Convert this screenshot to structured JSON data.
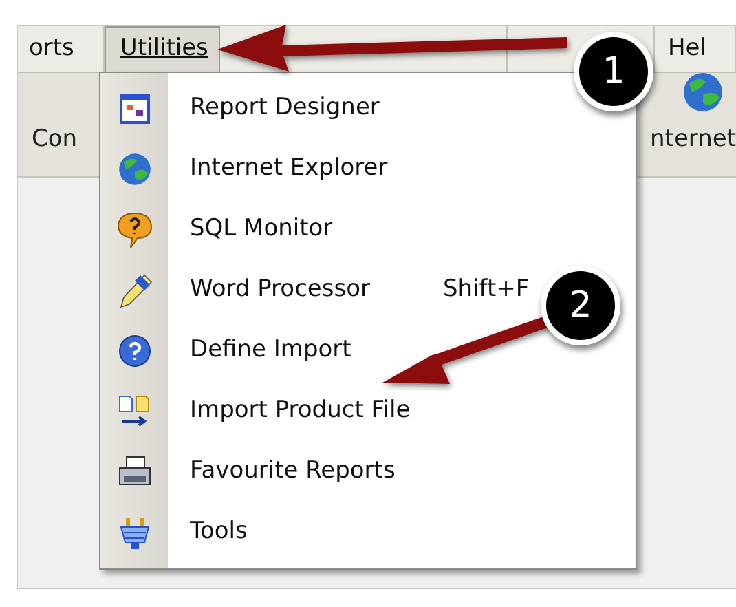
{
  "menu_bar": [
    {
      "label": "orts",
      "selected": false
    },
    {
      "label": "Utilities",
      "selected": true
    },
    {
      "label": "Hel",
      "selected": false
    }
  ],
  "toolbar": {
    "left_label": "Con",
    "right_label": "nternet"
  },
  "dropdown": [
    {
      "label": "Report Designer",
      "kind": "designer"
    },
    {
      "label": "Internet Explorer",
      "kind": "globe"
    },
    {
      "label": "SQL Monitor",
      "kind": "bubble"
    },
    {
      "label": "Word Processor",
      "kind": "pen",
      "shortcut": "Shift+F"
    },
    {
      "label": "Define Import",
      "kind": "help"
    },
    {
      "label": "Import Product File",
      "kind": "files"
    },
    {
      "label": "Favourite Reports",
      "kind": "printer"
    },
    {
      "label": "Tools",
      "kind": "plug"
    }
  ],
  "callouts": [
    {
      "number": "1"
    },
    {
      "number": "2"
    }
  ]
}
